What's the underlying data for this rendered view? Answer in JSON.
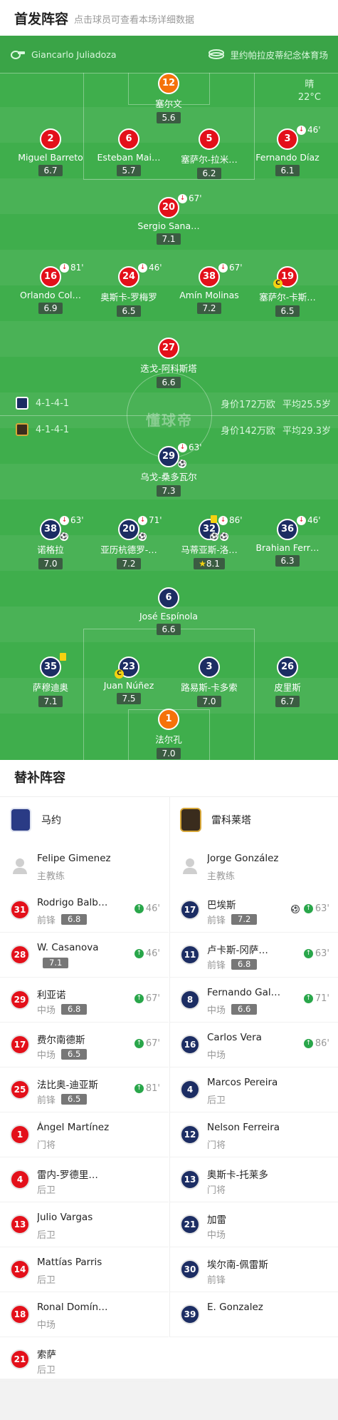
{
  "header": {
    "title": "首发阵容",
    "subtitle": "点击球员可查看本场详细数据"
  },
  "pitch": {
    "referee": "Giancarlo Juliadoza",
    "venue": "里约帕拉皮蒂纪念体育场",
    "weather": "晴",
    "temperature": "22°C",
    "watermark": "懂球帝",
    "home_formation": "4-1-4-1",
    "home_value": "身价172万欧",
    "home_age": "平均25.5岁",
    "away_formation": "4-1-4-1",
    "away_value": "身价142万欧",
    "away_age": "平均29.3岁"
  },
  "home_players": [
    {
      "num": "12",
      "name": "塞尔文",
      "rating": "5.6"
    },
    {
      "num": "2",
      "name": "Miguel Barreto",
      "rating": "6.7"
    },
    {
      "num": "6",
      "name": "Esteban Mai…",
      "rating": "5.7"
    },
    {
      "num": "5",
      "name": "塞萨尔-拉米…",
      "rating": "6.2"
    },
    {
      "num": "3",
      "name": "Fernando Díaz",
      "rating": "6.1",
      "sub_min": "46'"
    },
    {
      "num": "20",
      "name": "Sergio Sana…",
      "rating": "7.1",
      "sub_min": "67'"
    },
    {
      "num": "16",
      "name": "Orlando Col…",
      "rating": "6.9",
      "sub_min": "81'"
    },
    {
      "num": "24",
      "name": "奥斯卡-罗梅罗",
      "rating": "6.5",
      "sub_min": "46'"
    },
    {
      "num": "38",
      "name": "Amín Molinas",
      "rating": "7.2",
      "sub_min": "67'"
    },
    {
      "num": "19",
      "name": "塞萨尔-卡斯…",
      "rating": "6.5",
      "captain": "C"
    },
    {
      "num": "27",
      "name": "迭戈-阿科斯塔",
      "rating": "6.6"
    }
  ],
  "away_players": [
    {
      "num": "29",
      "name": "乌戈-桑多瓦尔",
      "rating": "7.3",
      "sub_min": "63'"
    },
    {
      "num": "38",
      "name": "诺格拉",
      "rating": "7.0",
      "sub_min": "63'"
    },
    {
      "num": "20",
      "name": "亚历杭德罗-…",
      "rating": "7.2",
      "sub_min": "71'"
    },
    {
      "num": "32",
      "name": "马蒂亚斯-洛…",
      "rating": "8.1",
      "sub_min": "86'",
      "star": "★"
    },
    {
      "num": "36",
      "name": "Brahian Ferr…",
      "rating": "6.3",
      "sub_min": "46'"
    },
    {
      "num": "6",
      "name": "José Espínola",
      "rating": "6.6"
    },
    {
      "num": "35",
      "name": "萨穆迪奥",
      "rating": "7.1"
    },
    {
      "num": "23",
      "name": "Juan Núñez",
      "rating": "7.5",
      "captain": "C"
    },
    {
      "num": "3",
      "name": "路易斯-卡多索",
      "rating": "7.0"
    },
    {
      "num": "26",
      "name": "皮里斯",
      "rating": "6.7"
    },
    {
      "num": "1",
      "name": "法尔孔",
      "rating": "7.0"
    }
  ],
  "subs": {
    "title": "替补阵容",
    "home": {
      "team": "马约",
      "coach": {
        "name": "Felipe Gimenez",
        "role": "主教练"
      },
      "players": [
        {
          "num": "31",
          "name": "Rodrigo Balb…",
          "pos": "前锋",
          "rating": "6.8",
          "sub": "46'"
        },
        {
          "num": "28",
          "name": "W. Casanova",
          "pos": "",
          "rating": "7.1",
          "sub": "46'"
        },
        {
          "num": "29",
          "name": "利亚诺",
          "pos": "中场",
          "rating": "6.8",
          "sub": "67'"
        },
        {
          "num": "17",
          "name": "费尔南德斯",
          "pos": "中场",
          "rating": "6.5",
          "sub": "67'"
        },
        {
          "num": "25",
          "name": "法比奥-迪亚斯",
          "pos": "前锋",
          "rating": "6.5",
          "sub": "81'"
        },
        {
          "num": "1",
          "name": "Ángel Martínez",
          "pos": "门将"
        },
        {
          "num": "4",
          "name": "雷内-罗德里…",
          "pos": "后卫"
        },
        {
          "num": "13",
          "name": "Julio Vargas",
          "pos": "后卫"
        },
        {
          "num": "14",
          "name": "Mattías Parris",
          "pos": "后卫"
        },
        {
          "num": "18",
          "name": "Ronal Domín…",
          "pos": "中场"
        },
        {
          "num": "21",
          "name": "索萨",
          "pos": "后卫"
        }
      ]
    },
    "away": {
      "team": "雷科莱塔",
      "coach": {
        "name": "Jorge González",
        "role": "主教练"
      },
      "players": [
        {
          "num": "17",
          "name": "巴埃斯",
          "pos": "前锋",
          "rating": "7.2",
          "sub": "63'",
          "goal": true
        },
        {
          "num": "11",
          "name": "卢卡斯-冈萨…",
          "pos": "前锋",
          "rating": "6.8",
          "sub": "63'"
        },
        {
          "num": "8",
          "name": "Fernando Gal…",
          "pos": "中场",
          "rating": "6.6",
          "sub": "71'"
        },
        {
          "num": "16",
          "name": "Carlos Vera",
          "pos": "中场",
          "sub": "86'"
        },
        {
          "num": "4",
          "name": "Marcos Pereira",
          "pos": "后卫"
        },
        {
          "num": "12",
          "name": "Nelson Ferreira",
          "pos": "门将"
        },
        {
          "num": "13",
          "name": "奥斯卡-托莱多",
          "pos": "门将"
        },
        {
          "num": "21",
          "name": "加雷",
          "pos": "中场"
        },
        {
          "num": "30",
          "name": "埃尔南-佩雷斯",
          "pos": "前锋"
        },
        {
          "num": "39",
          "name": "E. Gonzalez",
          "pos": ""
        }
      ]
    }
  },
  "colors": {
    "pitch": "#3fae4c",
    "home": "#e3101a",
    "away": "#1c2d63",
    "keeper": "#f5720a"
  },
  "icons": [
    "referee-whistle-icon",
    "stadium-icon",
    "sub-out-icon",
    "sub-in-icon",
    "ball-icon",
    "yellow-card-icon",
    "captain-icon",
    "coach-avatar-icon",
    "star-icon"
  ]
}
